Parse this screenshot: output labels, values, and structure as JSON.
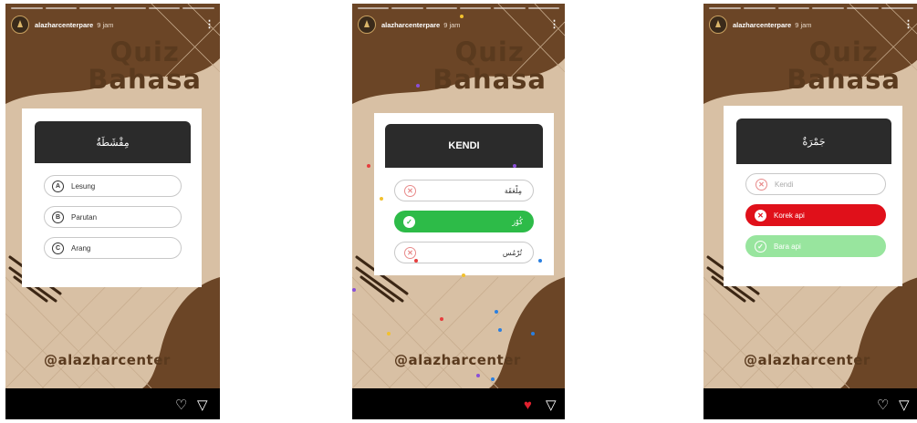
{
  "colors": {
    "background": "#d8c0a4",
    "brown": "#6b4526",
    "title": "#5a3a1e",
    "correct": "#2dbb48",
    "wrong": "#e0101a",
    "correct_light": "#98e59e"
  },
  "stories": [
    {
      "username": "alazharcenterpare",
      "time": "9 jam",
      "title_line1": "Quiz",
      "title_line2": "Bahasa",
      "question": "مِقْشَطَةٌ",
      "options": [
        {
          "letter": "A",
          "label": "Lesung"
        },
        {
          "letter": "B",
          "label": "Parutan"
        },
        {
          "letter": "C",
          "label": "Arang"
        }
      ],
      "handle": "@alazharcenter",
      "footer_icons": [
        "heart-outline-icon",
        "send-icon"
      ]
    },
    {
      "username": "alazharcenterpare",
      "time": "9 jam",
      "title_line1": "Quiz",
      "title_line2": "Bahasa",
      "question": "KENDI",
      "options": [
        {
          "label": "مِلْعَقَة",
          "state": "wrong"
        },
        {
          "label": "كُوْز",
          "state": "correct"
        },
        {
          "label": "تُرْمُس",
          "state": "wrong"
        }
      ],
      "handle": "@alazharcenter",
      "footer_icons": [
        "heart-filled-icon",
        "send-icon"
      ]
    },
    {
      "username": "alazharcenterpare",
      "time": "9 jam",
      "title_line1": "Quiz",
      "title_line2": "Bahasa",
      "question": "جَمْرَةٌ",
      "options": [
        {
          "label": "Kendi",
          "state": "wrong"
        },
        {
          "label": "Korek api",
          "state": "selected-wrong"
        },
        {
          "label": "Bara api",
          "state": "correct"
        }
      ],
      "handle": "@alazharcenter",
      "footer_icons": [
        "heart-outline-icon",
        "send-icon"
      ]
    }
  ]
}
